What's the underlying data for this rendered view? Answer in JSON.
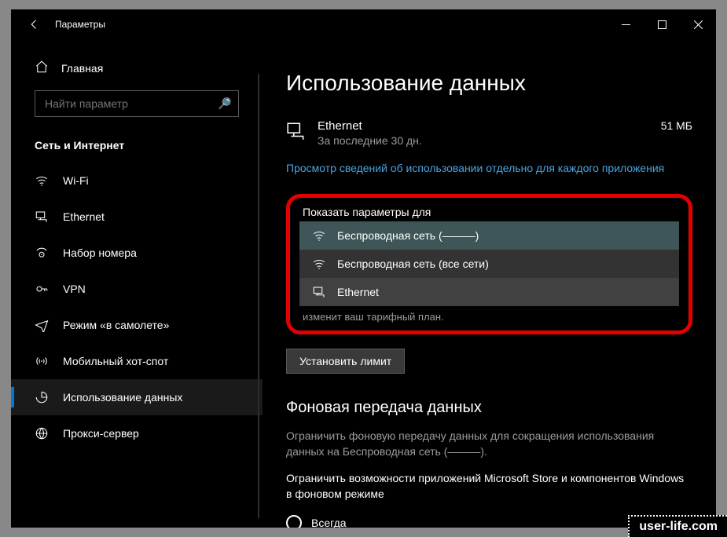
{
  "title": "Параметры",
  "search_placeholder": "Найти параметр",
  "home": "Главная",
  "group": "Сеть и Интернет",
  "nav": {
    "wifi": "Wi-Fi",
    "ethernet": "Ethernet",
    "dialup": "Набор номера",
    "vpn": "VPN",
    "airplane": "Режим «в самолете»",
    "hotspot": "Мобильный хот-спот",
    "datausage": "Использование данных",
    "proxy": "Прокси-сервер"
  },
  "page": {
    "heading": "Использование данных",
    "usage": {
      "iface": "Ethernet",
      "period": "За последние 30 дн.",
      "amount": "51 МБ"
    },
    "per_app_link": "Просмотр сведений об использовании отдельно для каждого приложения",
    "dd_label": "Показать параметры для",
    "dd": {
      "opt0": "Беспроводная сеть (———)",
      "opt1": "Беспроводная сеть (все сети)",
      "opt2": "Ethernet"
    },
    "plan_hint": "изменит ваш тарифный план.",
    "set_limit": "Установить лимит",
    "bg_heading": "Фоновая передача данных",
    "bg_desc": "Ограничить фоновую передачу данных для сокращения использования данных на Беспроводная сеть (———).",
    "bg_store": "Ограничить возможности приложений Microsoft Store и компонентов Windows в фоновом режиме",
    "radio_always": "Всегда"
  },
  "watermark": "user-life.com"
}
